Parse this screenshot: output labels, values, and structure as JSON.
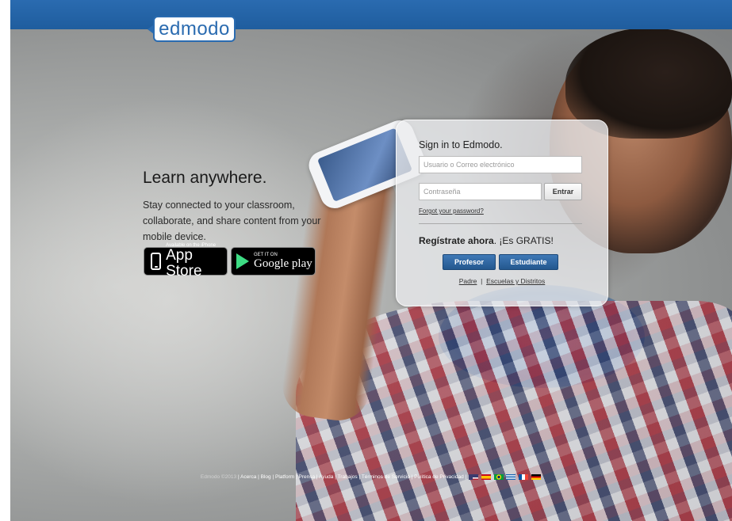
{
  "brand": {
    "logo_text": "edmodo",
    "accent_color": "#2a6bb0"
  },
  "promo": {
    "headline": "Learn anywhere.",
    "tagline": "Stay connected to your classroom, collaborate, and share content from your mobile device.",
    "app_store": {
      "small": "Available on the iPhone",
      "big": "App Store"
    },
    "google_play": {
      "small": "GET IT ON",
      "big": "Google play"
    }
  },
  "signin": {
    "title": "Sign in to Edmodo.",
    "username_placeholder": "Usuario o Correo electrónico",
    "password_placeholder": "Contraseña",
    "enter_label": "Entrar",
    "forgot_label": "Forgot your password?",
    "register_bold": "Regístrate ahora",
    "register_rest": ". ¡Es GRATIS!",
    "teacher_label": "Profesor",
    "student_label": "Estudiante",
    "parent_link": "Padre",
    "separator": "|",
    "schools_link": "Escuelas y Distritos"
  },
  "footer": {
    "copyright": "Edmodo ©2013",
    "links": [
      "Acerca",
      "Blog",
      "Platform",
      "Prensa",
      "Ayuda",
      "Trabajos",
      "Términos de Servicio",
      "Política de Privacidad"
    ],
    "flags": [
      "flag-us-icon",
      "flag-es-icon",
      "flag-br-icon",
      "flag-gr-icon",
      "flag-fr-icon",
      "flag-de-icon"
    ]
  }
}
